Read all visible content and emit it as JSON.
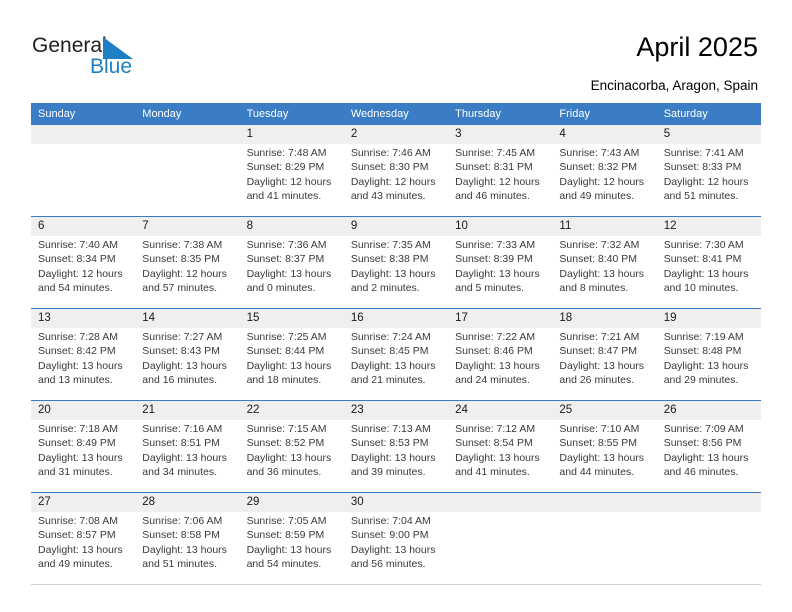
{
  "brand": {
    "name_part1": "General",
    "name_part2": "Blue",
    "accent_color": "#1f7fc4",
    "triangle_icon": "logo-triangle-icon"
  },
  "header": {
    "title": "April 2025",
    "location": "Encinacorba, Aragon, Spain"
  },
  "calendar": {
    "header_color": "#3a7dc4",
    "daynum_band_color": "#efefef",
    "weekdays": [
      "Sunday",
      "Monday",
      "Tuesday",
      "Wednesday",
      "Thursday",
      "Friday",
      "Saturday"
    ],
    "weeks": [
      [
        {
          "day": "",
          "lines": []
        },
        {
          "day": "",
          "lines": []
        },
        {
          "day": "1",
          "lines": [
            "Sunrise: 7:48 AM",
            "Sunset: 8:29 PM",
            "Daylight: 12 hours",
            "and 41 minutes."
          ]
        },
        {
          "day": "2",
          "lines": [
            "Sunrise: 7:46 AM",
            "Sunset: 8:30 PM",
            "Daylight: 12 hours",
            "and 43 minutes."
          ]
        },
        {
          "day": "3",
          "lines": [
            "Sunrise: 7:45 AM",
            "Sunset: 8:31 PM",
            "Daylight: 12 hours",
            "and 46 minutes."
          ]
        },
        {
          "day": "4",
          "lines": [
            "Sunrise: 7:43 AM",
            "Sunset: 8:32 PM",
            "Daylight: 12 hours",
            "and 49 minutes."
          ]
        },
        {
          "day": "5",
          "lines": [
            "Sunrise: 7:41 AM",
            "Sunset: 8:33 PM",
            "Daylight: 12 hours",
            "and 51 minutes."
          ]
        }
      ],
      [
        {
          "day": "6",
          "lines": [
            "Sunrise: 7:40 AM",
            "Sunset: 8:34 PM",
            "Daylight: 12 hours",
            "and 54 minutes."
          ]
        },
        {
          "day": "7",
          "lines": [
            "Sunrise: 7:38 AM",
            "Sunset: 8:35 PM",
            "Daylight: 12 hours",
            "and 57 minutes."
          ]
        },
        {
          "day": "8",
          "lines": [
            "Sunrise: 7:36 AM",
            "Sunset: 8:37 PM",
            "Daylight: 13 hours",
            "and 0 minutes."
          ]
        },
        {
          "day": "9",
          "lines": [
            "Sunrise: 7:35 AM",
            "Sunset: 8:38 PM",
            "Daylight: 13 hours",
            "and 2 minutes."
          ]
        },
        {
          "day": "10",
          "lines": [
            "Sunrise: 7:33 AM",
            "Sunset: 8:39 PM",
            "Daylight: 13 hours",
            "and 5 minutes."
          ]
        },
        {
          "day": "11",
          "lines": [
            "Sunrise: 7:32 AM",
            "Sunset: 8:40 PM",
            "Daylight: 13 hours",
            "and 8 minutes."
          ]
        },
        {
          "day": "12",
          "lines": [
            "Sunrise: 7:30 AM",
            "Sunset: 8:41 PM",
            "Daylight: 13 hours",
            "and 10 minutes."
          ]
        }
      ],
      [
        {
          "day": "13",
          "lines": [
            "Sunrise: 7:28 AM",
            "Sunset: 8:42 PM",
            "Daylight: 13 hours",
            "and 13 minutes."
          ]
        },
        {
          "day": "14",
          "lines": [
            "Sunrise: 7:27 AM",
            "Sunset: 8:43 PM",
            "Daylight: 13 hours",
            "and 16 minutes."
          ]
        },
        {
          "day": "15",
          "lines": [
            "Sunrise: 7:25 AM",
            "Sunset: 8:44 PM",
            "Daylight: 13 hours",
            "and 18 minutes."
          ]
        },
        {
          "day": "16",
          "lines": [
            "Sunrise: 7:24 AM",
            "Sunset: 8:45 PM",
            "Daylight: 13 hours",
            "and 21 minutes."
          ]
        },
        {
          "day": "17",
          "lines": [
            "Sunrise: 7:22 AM",
            "Sunset: 8:46 PM",
            "Daylight: 13 hours",
            "and 24 minutes."
          ]
        },
        {
          "day": "18",
          "lines": [
            "Sunrise: 7:21 AM",
            "Sunset: 8:47 PM",
            "Daylight: 13 hours",
            "and 26 minutes."
          ]
        },
        {
          "day": "19",
          "lines": [
            "Sunrise: 7:19 AM",
            "Sunset: 8:48 PM",
            "Daylight: 13 hours",
            "and 29 minutes."
          ]
        }
      ],
      [
        {
          "day": "20",
          "lines": [
            "Sunrise: 7:18 AM",
            "Sunset: 8:49 PM",
            "Daylight: 13 hours",
            "and 31 minutes."
          ]
        },
        {
          "day": "21",
          "lines": [
            "Sunrise: 7:16 AM",
            "Sunset: 8:51 PM",
            "Daylight: 13 hours",
            "and 34 minutes."
          ]
        },
        {
          "day": "22",
          "lines": [
            "Sunrise: 7:15 AM",
            "Sunset: 8:52 PM",
            "Daylight: 13 hours",
            "and 36 minutes."
          ]
        },
        {
          "day": "23",
          "lines": [
            "Sunrise: 7:13 AM",
            "Sunset: 8:53 PM",
            "Daylight: 13 hours",
            "and 39 minutes."
          ]
        },
        {
          "day": "24",
          "lines": [
            "Sunrise: 7:12 AM",
            "Sunset: 8:54 PM",
            "Daylight: 13 hours",
            "and 41 minutes."
          ]
        },
        {
          "day": "25",
          "lines": [
            "Sunrise: 7:10 AM",
            "Sunset: 8:55 PM",
            "Daylight: 13 hours",
            "and 44 minutes."
          ]
        },
        {
          "day": "26",
          "lines": [
            "Sunrise: 7:09 AM",
            "Sunset: 8:56 PM",
            "Daylight: 13 hours",
            "and 46 minutes."
          ]
        }
      ],
      [
        {
          "day": "27",
          "lines": [
            "Sunrise: 7:08 AM",
            "Sunset: 8:57 PM",
            "Daylight: 13 hours",
            "and 49 minutes."
          ]
        },
        {
          "day": "28",
          "lines": [
            "Sunrise: 7:06 AM",
            "Sunset: 8:58 PM",
            "Daylight: 13 hours",
            "and 51 minutes."
          ]
        },
        {
          "day": "29",
          "lines": [
            "Sunrise: 7:05 AM",
            "Sunset: 8:59 PM",
            "Daylight: 13 hours",
            "and 54 minutes."
          ]
        },
        {
          "day": "30",
          "lines": [
            "Sunrise: 7:04 AM",
            "Sunset: 9:00 PM",
            "Daylight: 13 hours",
            "and 56 minutes."
          ]
        },
        {
          "day": "",
          "lines": []
        },
        {
          "day": "",
          "lines": []
        },
        {
          "day": "",
          "lines": []
        }
      ]
    ]
  }
}
